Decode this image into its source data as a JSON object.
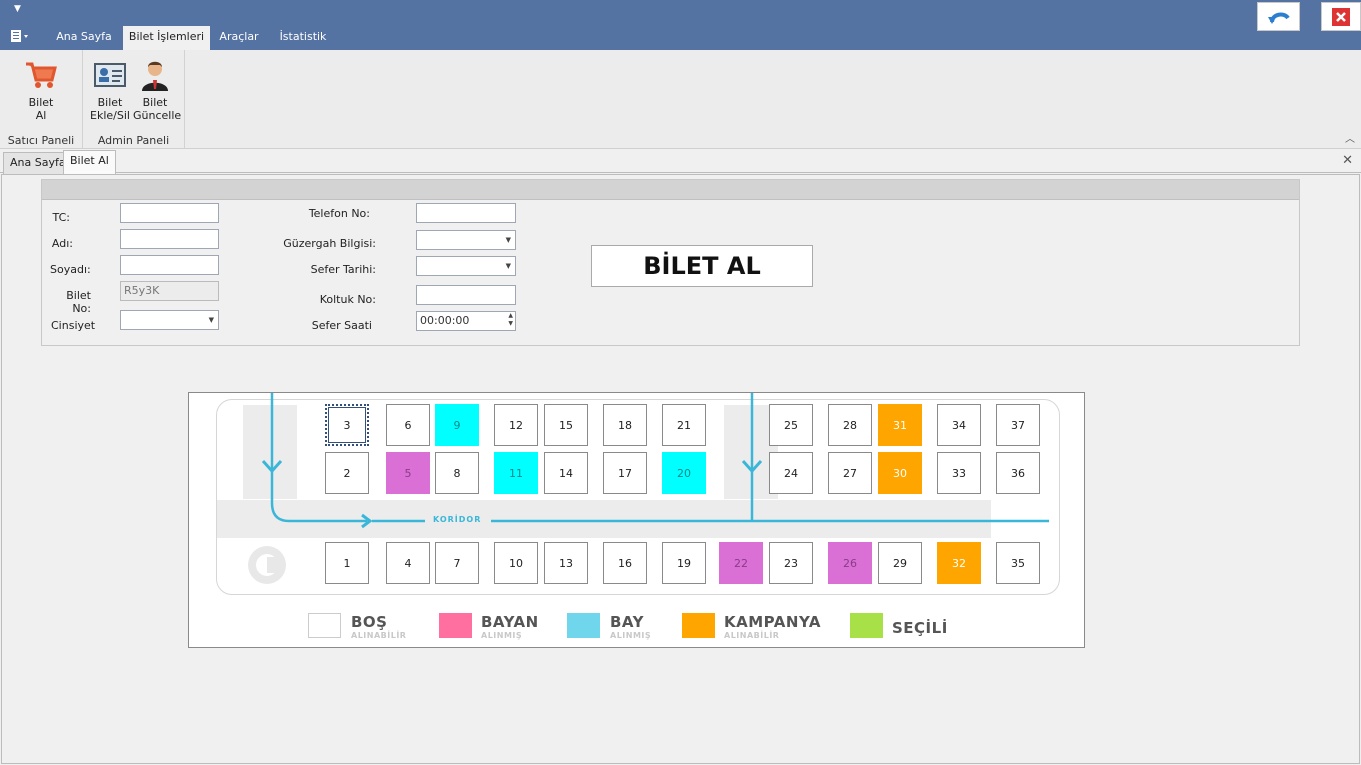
{
  "ribbon": {
    "tabs": [
      "Ana Sayfa",
      "Bilet İşlemleri",
      "Araçlar",
      "İstatistik"
    ],
    "active_tab": "Bilet İşlemleri",
    "groups": [
      {
        "label": "Satıcı Paneli",
        "buttons": [
          {
            "line1": "Bilet",
            "line2": "Al",
            "icon": "shopping-cart-icon"
          }
        ]
      },
      {
        "label": "Admin Paneli",
        "buttons": [
          {
            "line1": "Bilet",
            "line2": "Ekle/Sil",
            "icon": "id-card-icon"
          },
          {
            "line1": "Bilet",
            "line2": "Güncelle",
            "icon": "businessman-icon"
          }
        ]
      }
    ]
  },
  "doc_tabs": [
    "Ana Sayfa",
    "Bilet Al"
  ],
  "active_doc_tab": "Bilet Al",
  "form": {
    "tc_label": "TC:",
    "adi_label": "Adı:",
    "soyadi_label": "Soyadı:",
    "biletno_label": "Bilet No:",
    "biletno_value": "R5y3K",
    "cinsiyet_label": "Cinsiyet",
    "telefon_label": "Telefon No:",
    "guzergah_label": "Güzergah Bilgisi:",
    "sefer_tarihi_label": "Sefer Tarihi:",
    "koltuk_label": "Koltuk No:",
    "sefer_saati_label": "Sefer Saati",
    "sefer_saati_value": "00:00:00",
    "buy_button": "BİLET AL"
  },
  "seat_map": {
    "corridor_label": "KORİDOR",
    "seats": [
      {
        "no": "3",
        "state": "selected"
      },
      {
        "no": "6",
        "state": "empty"
      },
      {
        "no": "9",
        "state": "bay"
      },
      {
        "no": "12",
        "state": "empty"
      },
      {
        "no": "15",
        "state": "empty"
      },
      {
        "no": "18",
        "state": "empty"
      },
      {
        "no": "21",
        "state": "empty"
      },
      {
        "no": "25",
        "state": "empty"
      },
      {
        "no": "28",
        "state": "empty"
      },
      {
        "no": "31",
        "state": "kampanya"
      },
      {
        "no": "34",
        "state": "empty"
      },
      {
        "no": "37",
        "state": "empty"
      },
      {
        "no": "2",
        "state": "empty"
      },
      {
        "no": "5",
        "state": "bayan"
      },
      {
        "no": "8",
        "state": "empty"
      },
      {
        "no": "11",
        "state": "bay"
      },
      {
        "no": "14",
        "state": "empty"
      },
      {
        "no": "17",
        "state": "empty"
      },
      {
        "no": "20",
        "state": "bay"
      },
      {
        "no": "24",
        "state": "empty"
      },
      {
        "no": "27",
        "state": "empty"
      },
      {
        "no": "30",
        "state": "kampanya"
      },
      {
        "no": "33",
        "state": "empty"
      },
      {
        "no": "36",
        "state": "empty"
      },
      {
        "no": "1",
        "state": "empty"
      },
      {
        "no": "4",
        "state": "empty"
      },
      {
        "no": "7",
        "state": "empty"
      },
      {
        "no": "10",
        "state": "empty"
      },
      {
        "no": "13",
        "state": "empty"
      },
      {
        "no": "16",
        "state": "empty"
      },
      {
        "no": "19",
        "state": "empty"
      },
      {
        "no": "22",
        "state": "bayan"
      },
      {
        "no": "23",
        "state": "empty"
      },
      {
        "no": "26",
        "state": "bayan"
      },
      {
        "no": "29",
        "state": "empty"
      },
      {
        "no": "32",
        "state": "kampanya"
      },
      {
        "no": "35",
        "state": "empty"
      }
    ],
    "legend": [
      {
        "title": "BOŞ",
        "sub": "ALINABİLİR",
        "color": "#ffffff"
      },
      {
        "title": "BAYAN",
        "sub": "ALINMIŞ",
        "color": "#ff6fa0"
      },
      {
        "title": "BAY",
        "sub": "ALINMIŞ",
        "color": "#6fd6ec"
      },
      {
        "title": "KAMPANYA",
        "sub": "ALINABİLİR",
        "color": "#ffa500"
      },
      {
        "title": "SEÇİLİ",
        "sub": "",
        "color": "#a8e048"
      }
    ]
  }
}
